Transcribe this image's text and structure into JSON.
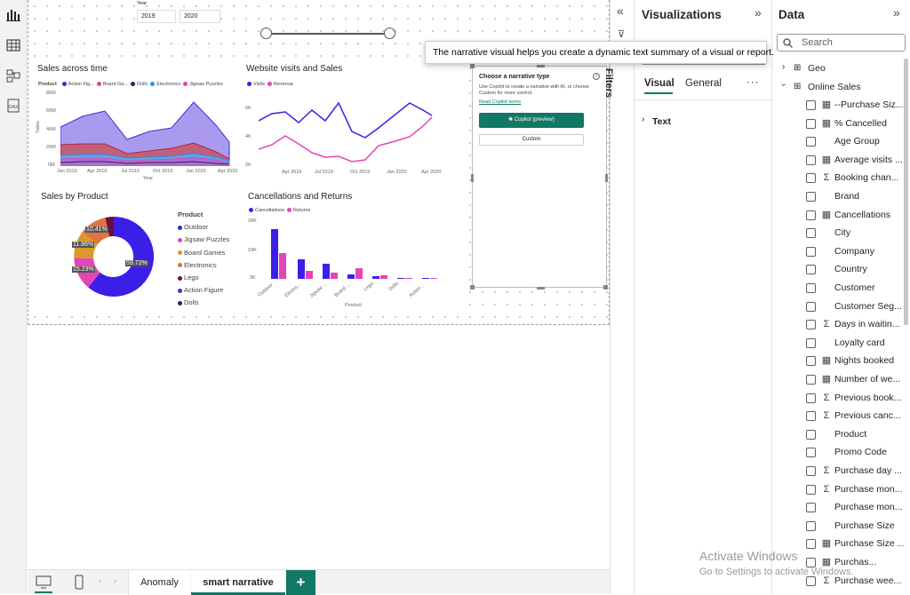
{
  "colors": {
    "outdoor": "#3b1fe8",
    "jigsaw": "#e444b5",
    "board": "#d99a2b",
    "electronics": "#e0743c",
    "lego": "#6b0f3d",
    "action": "#4a27d6",
    "dolls": "#1f2a5e",
    "visits": "#3b1fe8",
    "revenue": "#e444b5",
    "copilot": "#117865"
  },
  "slicer": {
    "title": "Year",
    "from": "2019",
    "to": "2020"
  },
  "sales_time": {
    "title": "Sales across time",
    "legend_title": "Product",
    "legend": [
      "Action Fig...",
      "Board Ga...",
      "Dolls",
      "Electronics",
      "Jigsaw Puzzles"
    ],
    "yticks": [
      "80M",
      "60M",
      "40M",
      "20M",
      "0M"
    ],
    "xticks": [
      "Jan 2019",
      "Apr 2019",
      "Jul 2019",
      "Oct 2019",
      "Jan 2020",
      "Apr 2020"
    ],
    "ylabel": "Sales",
    "xlabel": "Year"
  },
  "website": {
    "title": "Website visits and Sales",
    "legend": [
      "Visits",
      "Revenue"
    ],
    "yticks": [
      "6K",
      "4K",
      "2K"
    ],
    "xticks": [
      "Apr 2019",
      "Jul 2019",
      "Oct 2019",
      "Jan 2020",
      "Apr 2020"
    ]
  },
  "narrative": {
    "title": "Choose a narrative type",
    "desc": "Use Copilot to create a narrative with AI, or choose Custom for more control.",
    "link": "Read Copilot terms",
    "copilot_btn": "Copilot (preview)",
    "custom_btn": "Custom"
  },
  "tooltip": "The narrative visual helps you create a dynamic text summary of a visual or report.",
  "sales_product": {
    "title": "Sales by Product",
    "legend_title": "Product",
    "legend": [
      "Outdoor",
      "Jigsaw Puzzles",
      "Board Games",
      "Electronics",
      "Lego",
      "Action Figure",
      "Dolls"
    ],
    "labels": [
      "59.72%",
      "15.23%",
      "11.86%",
      "10.41%"
    ]
  },
  "cancel": {
    "title": "Cancellations and Returns",
    "legend": [
      "Cancellations",
      "Returns"
    ],
    "yticks": [
      "20K",
      "10K",
      "0K"
    ],
    "xticks": [
      "Outdoor",
      "Electro...",
      "Jigsaw ...",
      "Board ...",
      "Lego",
      "Dolls",
      "Action ..."
    ],
    "xlabel": "Product"
  },
  "tabs": {
    "anomaly": "Anomaly",
    "smart": "smart narrative",
    "add": "+"
  },
  "viz": {
    "title": "Visualizations",
    "tab_visual": "Visual",
    "tab_general": "General",
    "more": "···",
    "section": "Text",
    "filters_label": "Filters"
  },
  "data": {
    "title": "Data",
    "search_placeholder": "Search",
    "tables": [
      "Geo",
      "Online Sales"
    ],
    "fields": [
      {
        "name": "--Purchase Siz...",
        "icon": "calc"
      },
      {
        "name": "% Cancelled",
        "icon": "calc"
      },
      {
        "name": "Age Group",
        "icon": ""
      },
      {
        "name": "Average visits ...",
        "icon": "calc"
      },
      {
        "name": "Booking chan...",
        "icon": "sum"
      },
      {
        "name": "Brand",
        "icon": ""
      },
      {
        "name": "Cancellations",
        "icon": "calc"
      },
      {
        "name": "City",
        "icon": ""
      },
      {
        "name": "Company",
        "icon": ""
      },
      {
        "name": "Country",
        "icon": ""
      },
      {
        "name": "Customer",
        "icon": ""
      },
      {
        "name": "Customer Seg...",
        "icon": ""
      },
      {
        "name": "Days in waitin...",
        "icon": "sum"
      },
      {
        "name": "Loyalty card",
        "icon": ""
      },
      {
        "name": "Nights booked",
        "icon": "calc"
      },
      {
        "name": "Number of we...",
        "icon": "calc"
      },
      {
        "name": "Previous book...",
        "icon": "sum"
      },
      {
        "name": "Previous canc...",
        "icon": "sum"
      },
      {
        "name": "Product",
        "icon": ""
      },
      {
        "name": "Promo Code",
        "icon": ""
      },
      {
        "name": "Purchase day ...",
        "icon": "sum"
      },
      {
        "name": "Purchase mon...",
        "icon": "sum"
      },
      {
        "name": "Purchase mon...",
        "icon": ""
      },
      {
        "name": "Purchase Size",
        "icon": ""
      },
      {
        "name": "Purchase Size ...",
        "icon": "calc"
      },
      {
        "name": "Purchas...",
        "icon": "calc"
      },
      {
        "name": "Purchase wee...",
        "icon": "sum"
      }
    ]
  },
  "watermark": {
    "line1": "Activate Windows",
    "line2": "Go to Settings to activate Windows."
  }
}
